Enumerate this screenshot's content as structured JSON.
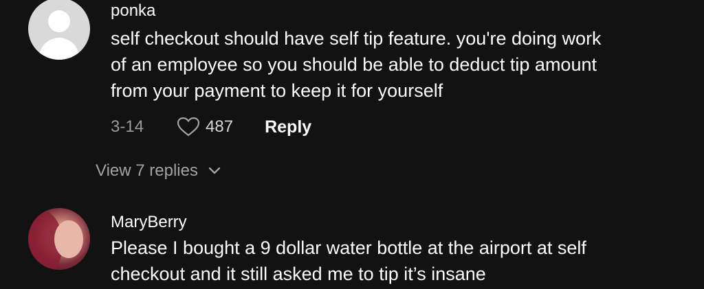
{
  "comments": [
    {
      "username": "ponka",
      "avatar": "default-avatar",
      "lines": [
        "self checkout should have self tip feature. you're doing work",
        "of an employee so you should be able to deduct tip amount",
        "from your payment to keep it for yourself"
      ],
      "date": "3-14",
      "likes": "487",
      "reply_label": "Reply",
      "view_replies_label": "View 7 replies"
    },
    {
      "username": "MaryBerry",
      "avatar": "profile-photo",
      "lines": [
        "Please I bought a 9 dollar water bottle at the airport at self",
        "checkout and it still asked me to tip it’s insane"
      ]
    }
  ],
  "icons": {
    "like": "heart-outline-icon",
    "expand": "chevron-down-icon"
  },
  "colors": {
    "background": "#121212",
    "text_primary": "#ffffff",
    "text_secondary": "#a3a3a3"
  }
}
